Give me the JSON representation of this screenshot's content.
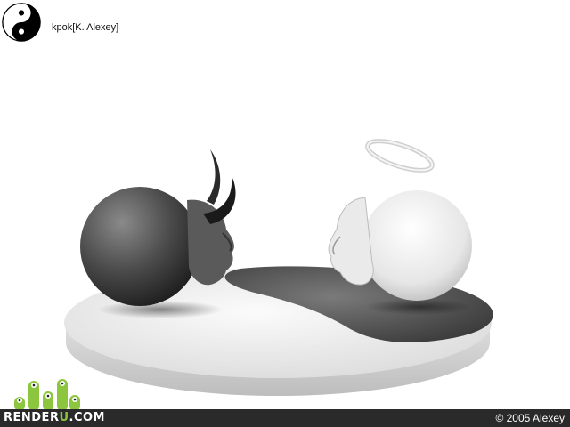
{
  "header": {
    "author_label": "kpok[K. Alexey]",
    "logo_icon": "yin-yang-icon"
  },
  "scene": {
    "subjects": [
      "devil-sphere-head",
      "angel-sphere-head",
      "yin-yang-platform"
    ]
  },
  "footer": {
    "brand_prefix": "RENDER",
    "brand_accent": "U",
    "brand_suffix": ".COM",
    "copyright": "© 2005 Alexey"
  },
  "colors": {
    "footer_bg": "#2a2a2a",
    "brand_green": "#8cc63f",
    "background": "#ffffff"
  }
}
